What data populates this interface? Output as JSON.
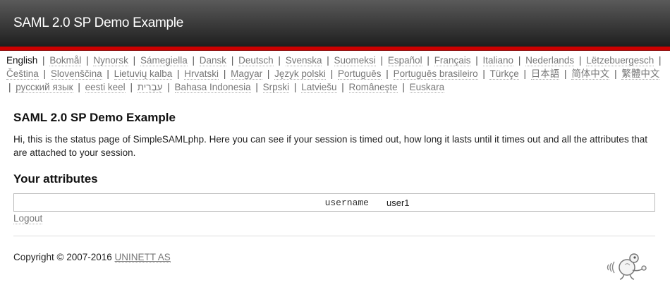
{
  "header": {
    "title": "SAML 2.0 SP Demo Example"
  },
  "languages": {
    "current": "English",
    "items": [
      "Bokmål",
      "Nynorsk",
      "Sámegiella",
      "Dansk",
      "Deutsch",
      "Svenska",
      "Suomeksi",
      "Español",
      "Français",
      "Italiano",
      "Nederlands",
      "Lëtzebuergesch",
      "Čeština",
      "Slovenščina",
      "Lietuvių kalba",
      "Hrvatski",
      "Magyar",
      "Język polski",
      "Português",
      "Português brasileiro",
      "Türkçe",
      "日本語",
      "简体中文",
      "繁體中文",
      "русский язык",
      "eesti keel",
      "עִבְרִית",
      "Bahasa Indonesia",
      "Srpski",
      "Latviešu",
      "Românește",
      "Euskara"
    ]
  },
  "main": {
    "title": "SAML 2.0 SP Demo Example",
    "intro": "Hi, this is the status page of SimpleSAMLphp. Here you can see if your session is timed out, how long it lasts until it times out and all the attributes that are attached to your session.",
    "attributes_heading": "Your attributes",
    "attributes": [
      {
        "name": "username",
        "value": "user1"
      }
    ],
    "logout_label": "Logout"
  },
  "footer": {
    "copyright": "Copyright © 2007-2016 ",
    "org": "UNINETT AS",
    "mascot_icon": "simplesamlphp-mascot-icon"
  },
  "colors": {
    "accent_bar": "#cc0000",
    "header_top": "#5a5a5a",
    "header_bottom": "#1e1e1e"
  }
}
